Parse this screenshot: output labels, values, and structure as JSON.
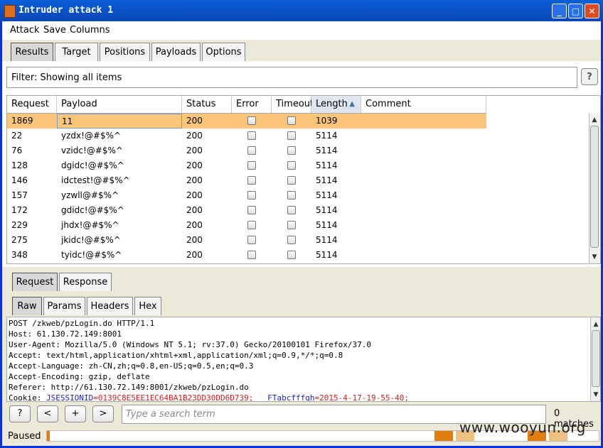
{
  "window": {
    "title": "Intruder attack 1"
  },
  "menu": [
    "Attack",
    "Save",
    "Columns"
  ],
  "main_tabs": [
    "Results",
    "Target",
    "Positions",
    "Payloads",
    "Options"
  ],
  "filter": {
    "text": "Filter: Showing all items",
    "help_label": "?"
  },
  "table": {
    "columns": [
      "Request",
      "Payload",
      "Status",
      "Error",
      "Timeout",
      "Length",
      "Comment"
    ],
    "sorted_column": "Length",
    "rows": [
      {
        "request": "1869",
        "payload": "11",
        "status": "200",
        "length": "1039",
        "selected": true
      },
      {
        "request": "22",
        "payload": "yzdx!@#$%^",
        "status": "200",
        "length": "5114"
      },
      {
        "request": "76",
        "payload": "vzidc!@#$%^",
        "status": "200",
        "length": "5114"
      },
      {
        "request": "128",
        "payload": "dgidc!@#$%^",
        "status": "200",
        "length": "5114"
      },
      {
        "request": "146",
        "payload": "idctest!@#$%^",
        "status": "200",
        "length": "5114"
      },
      {
        "request": "157",
        "payload": "yzwll@#$%^",
        "status": "200",
        "length": "5114"
      },
      {
        "request": "172",
        "payload": "gdidc!@#$%^",
        "status": "200",
        "length": "5114"
      },
      {
        "request": "229",
        "payload": "jhdx!@#$%^",
        "status": "200",
        "length": "5114"
      },
      {
        "request": "275",
        "payload": "jkidc!@#$%^",
        "status": "200",
        "length": "5114"
      },
      {
        "request": "348",
        "payload": "tyidc!@#$%^",
        "status": "200",
        "length": "5114"
      }
    ]
  },
  "req_tabs": [
    "Request",
    "Response"
  ],
  "view_tabs": [
    "Raw",
    "Params",
    "Headers",
    "Hex"
  ],
  "raw": {
    "lines": [
      "POST /zkweb/pzLogin.do HTTP/1.1",
      "Host: 61.130.72.149:8001",
      "User-Agent: Mozilla/5.0 (Windows NT 5.1; rv:37.0) Gecko/20100101 Firefox/37.0",
      "Accept: text/html,application/xhtml+xml,application/xml;q=0.9,*/*;q=0.8",
      "Accept-Language: zh-CN,zh;q=0.8,en-US;q=0.5,en;q=0.3",
      "Accept-Encoding: gzip, deflate",
      "Referer: http://61.130.72.149:8001/zkweb/pzLogin.do"
    ],
    "cookie_prefix": "Cookie: ",
    "cookie_name1": "JSESSIONID",
    "cookie_value1": "=0139C8E5EE1EC64BA1B23DD30DD6D739;",
    "cookie_name2": "FTabcfffgh",
    "cookie_value2": "=2015-4-17-19-55-40;"
  },
  "search": {
    "help_label": "?",
    "prev_label": "<",
    "add_label": "+",
    "next_label": ">",
    "placeholder": "Type a search term",
    "matches": "0 matches"
  },
  "status": {
    "text": "Paused",
    "progress_fraction": 0.0
  },
  "watermark": "www.wooyun.org",
  "colors": {
    "selected_row": "#fbc67a",
    "progress": "#e07e10",
    "titlebar": "#0a4fc4"
  }
}
